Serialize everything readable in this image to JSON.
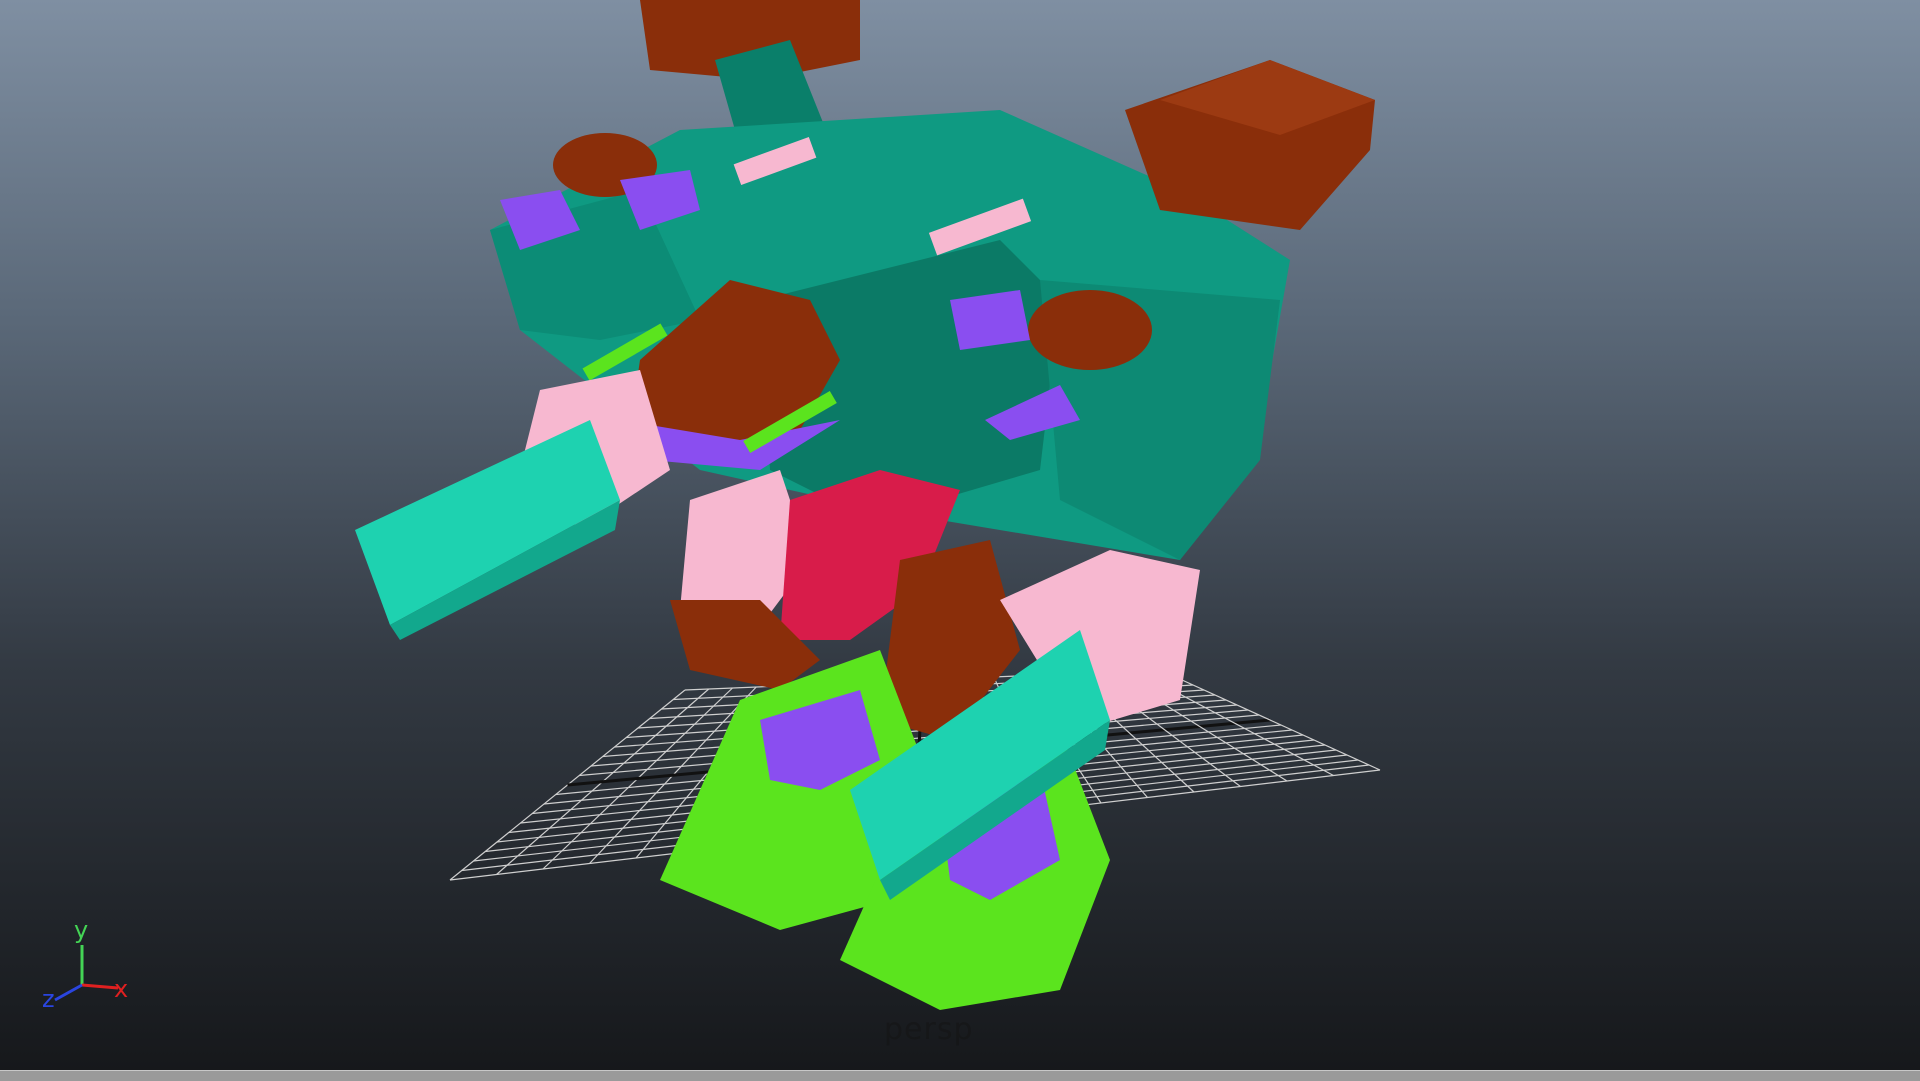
{
  "viewport": {
    "camera_label": "persp",
    "axis_labels": {
      "x": "x",
      "y": "y",
      "z": "z"
    }
  },
  "colors": {
    "body_teal": "#0f9a82",
    "body_teal_dark": "#0a6e5c",
    "armor_brown": "#8a2e0a",
    "accent_pink": "#f7b8d0",
    "accent_purple": "#8a4ef0",
    "leg_green": "#5be41e",
    "cannon_cyan": "#1ed2b0",
    "crotch_red": "#d81c4a",
    "grid_line": "#cfcfcf"
  }
}
